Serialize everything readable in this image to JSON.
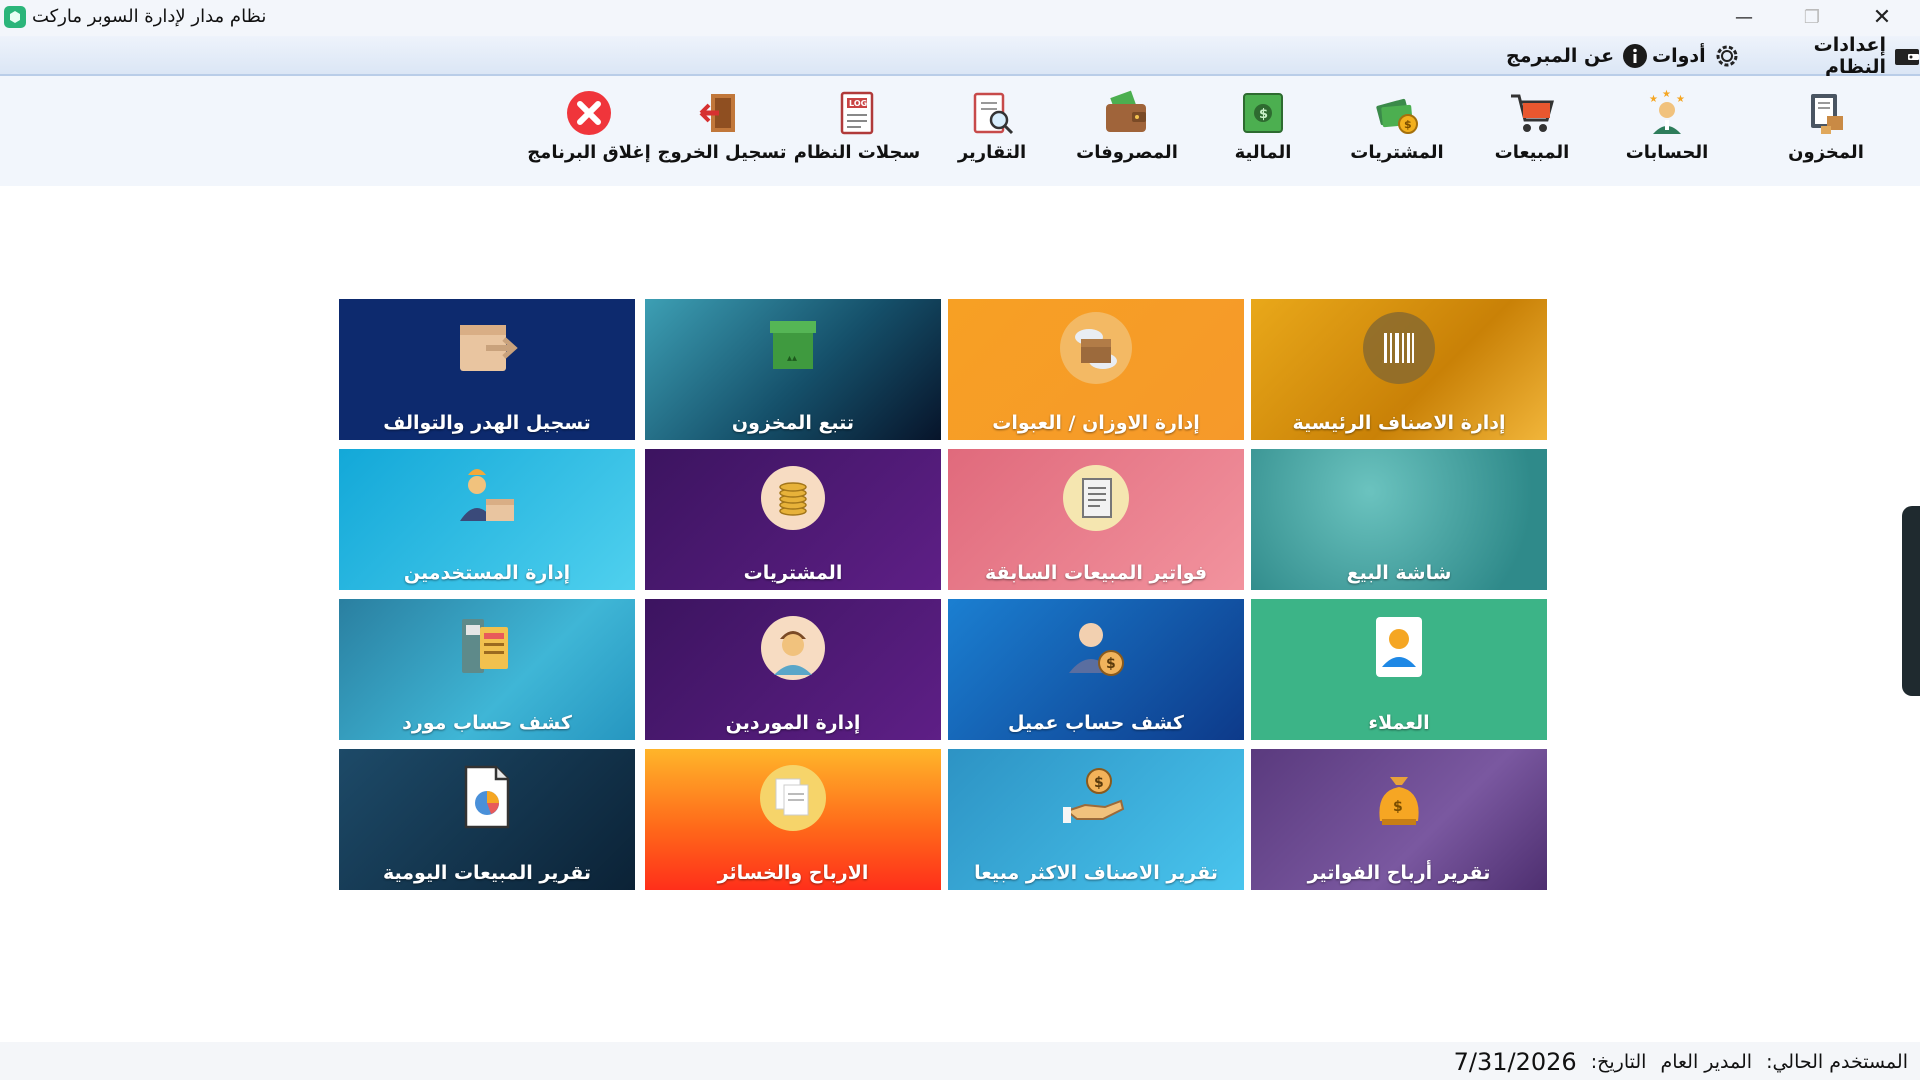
{
  "window": {
    "title": "نظام مدار لإدارة السوبر ماركت",
    "minimize": "—",
    "maximize": "❐",
    "close": "✕"
  },
  "menu": {
    "settings": "إعدادات النظام",
    "tools": "أدوات",
    "about": "عن المبرمج"
  },
  "toolbar": {
    "items": [
      {
        "id": "inventory",
        "label": "المخزون"
      },
      {
        "id": "accounts",
        "label": "الحسابات"
      },
      {
        "id": "sales",
        "label": "المبيعات"
      },
      {
        "id": "purchases",
        "label": "المشتريات"
      },
      {
        "id": "finance",
        "label": "المالية"
      },
      {
        "id": "expenses",
        "label": "المصروفات"
      },
      {
        "id": "reports",
        "label": "التقارير"
      },
      {
        "id": "logs",
        "label": "سجلات النظام"
      },
      {
        "id": "logout",
        "label": "تسجيل الخروج"
      },
      {
        "id": "exit",
        "label": "إغلاق البرنامج"
      }
    ]
  },
  "tiles": [
    {
      "id": "main-items",
      "label": "إدارة الاصناف الرئيسية"
    },
    {
      "id": "weights",
      "label": "إدارة الاوزان / العبوات"
    },
    {
      "id": "stock-tracking",
      "label": "تتبع المخزون"
    },
    {
      "id": "waste",
      "label": "تسجيل الهدر والتوالف"
    },
    {
      "id": "pos",
      "label": "شاشة البيع"
    },
    {
      "id": "prev-invoices",
      "label": "فواتير المبيعات السابقة"
    },
    {
      "id": "purchases",
      "label": "المشتريات"
    },
    {
      "id": "users",
      "label": "إدارة المستخدمين"
    },
    {
      "id": "customers",
      "label": "العملاء"
    },
    {
      "id": "customer-statement",
      "label": "كشف حساب عميل"
    },
    {
      "id": "suppliers",
      "label": "إدارة الموردين"
    },
    {
      "id": "supplier-statement",
      "label": "كشف حساب مورد"
    },
    {
      "id": "invoice-profits",
      "label": "تقرير أرباح الفواتير"
    },
    {
      "id": "best-sellers",
      "label": "تقرير الاصناف الاكثر مبيعا"
    },
    {
      "id": "profit-loss",
      "label": "الارباح والخسائر"
    },
    {
      "id": "daily-sales",
      "label": "تقرير المبيعات اليومية"
    }
  ],
  "status": {
    "user_label": "المستخدم الحالي:",
    "user_value": "المدير العام",
    "date_label": "التاريخ:",
    "date_value": "7/31/2026"
  }
}
